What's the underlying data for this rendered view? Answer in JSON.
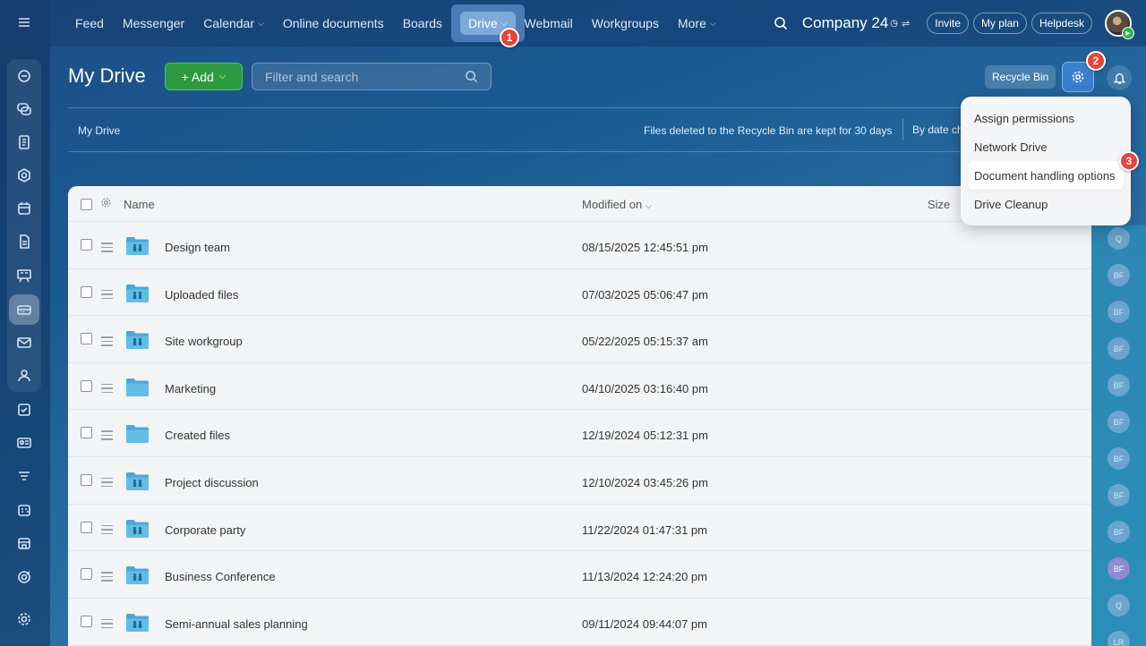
{
  "nav": {
    "links": [
      "Feed",
      "Messenger",
      "Calendar",
      "Online documents",
      "Boards",
      "Drive",
      "Webmail",
      "Workgroups",
      "More"
    ],
    "company": "Company 24",
    "invite": "Invite",
    "my_plan": "My plan",
    "helpdesk": "Helpdesk"
  },
  "page": {
    "title": "My Drive",
    "add_label": "+ Add",
    "search_placeholder": "Filter and search",
    "recycle_bin": "Recycle Bin",
    "breadcrumb": "My Drive",
    "recycle_note": "Files deleted to the Recycle Bin are kept for 30 days",
    "sort_note": "By date ch"
  },
  "table": {
    "col_name": "Name",
    "col_modified": "Modified on",
    "col_size": "Size",
    "rows": [
      {
        "name": "Design team",
        "modified": "08/15/2025 12:45:51 pm",
        "shared": true
      },
      {
        "name": "Uploaded files",
        "modified": "07/03/2025 05:06:47 pm",
        "shared": true
      },
      {
        "name": "Site workgroup",
        "modified": "05/22/2025 05:15:37 am",
        "shared": true
      },
      {
        "name": "Marketing",
        "modified": "04/10/2025 03:16:40 pm",
        "shared": false
      },
      {
        "name": "Created files",
        "modified": "12/19/2024 05:12:31 pm",
        "shared": false
      },
      {
        "name": "Project discussion",
        "modified": "12/10/2024 03:45:26 pm",
        "shared": true
      },
      {
        "name": "Corporate party",
        "modified": "11/22/2024 01:47:31 pm",
        "shared": true
      },
      {
        "name": "Business Conference",
        "modified": "11/13/2024 12:24:20 pm",
        "shared": true
      },
      {
        "name": "Semi-annual sales planning",
        "modified": "09/11/2024 09:44:07 pm",
        "shared": true
      }
    ]
  },
  "menu": {
    "items": [
      "Assign permissions",
      "Network Drive",
      "Document handling options",
      "Drive Cleanup"
    ]
  },
  "badges": {
    "b1": "1",
    "b2": "2",
    "b3": "3"
  },
  "right_avatars": [
    "Q",
    "BF",
    "BF",
    "BF",
    "BF",
    "BF",
    "BF",
    "BF",
    "BF",
    "BF",
    "Q",
    "LR"
  ],
  "colors": {
    "accent": "#3a7fcd",
    "add": "#2e9a3f",
    "badge": "#e9433a",
    "folder": "#4aa8d8"
  }
}
